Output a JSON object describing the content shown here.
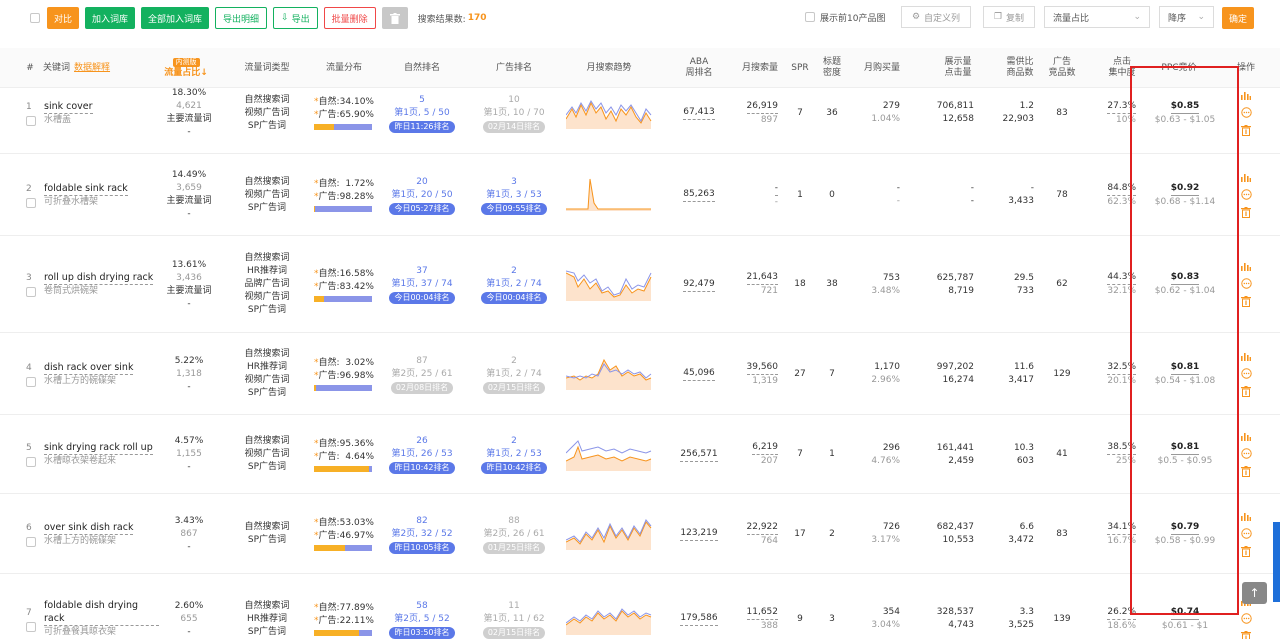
{
  "toolbar": {
    "compare": "对比",
    "add_to_library": "加入词库",
    "add_all_to_library": "全部加入词库",
    "export_details": "导出明细",
    "export": "导出",
    "batch_delete": "批量删除",
    "result_label": "搜索结果数:",
    "result_count": "170",
    "show_top10": "展示前10产品图",
    "custom": "自定义列",
    "copy": "复制",
    "sort_field": "流量占比",
    "sort_order": "降序",
    "confirm": "确定"
  },
  "header": {
    "hash": "#",
    "keyword": "关键词",
    "data_explain": "数据解释",
    "beta": "内测版",
    "flow_share": "流量占比↓",
    "flow_type": "流量词类型",
    "flow_dist": "流量分布",
    "organic_rank": "自然排名",
    "ad_rank": "广告排名",
    "monthly_trend": "月搜索趋势",
    "aba_1": "ABA",
    "aba_2": "周排名",
    "monthly_search": "月搜索量",
    "spr": "SPR",
    "title_1": "标题",
    "title_2": "密度",
    "monthly_buy": "月购买量",
    "impr_1": "展示量",
    "impr_2": "点击量",
    "supply_1": "需供比",
    "supply_2": "商品数",
    "ads_1": "广告",
    "ads_2": "竞品数",
    "click_1": "点击",
    "click_2": "集中度",
    "ppc": "PPC竞价",
    "ops": "操作"
  },
  "rows": [
    {
      "idx": "1",
      "kw": "sink cover",
      "kw_zh": "水槽盖",
      "share": "18.30%",
      "share_n": "4,621",
      "main": "主要流量词",
      "dash": "-",
      "types": [
        "自然搜索词",
        "视频广告词",
        "SP广告词"
      ],
      "org_label": "自然:",
      "org_pct": "34.10%",
      "ad_label": "广告:",
      "ad_pct": "65.90%",
      "org_frac": 0.341,
      "org_rank": "5",
      "org_page": "第1页, 5 / 50",
      "org_badge": "昨日11:26排名",
      "org_rank_c": "b",
      "ad_rank": "10",
      "ad_page": "第1页, 10 / 70",
      "ad_badge": "02月14日排名",
      "ad_rank_c": "g",
      "trend": "t1",
      "aba": "67,413",
      "ms": "26,919",
      "ms2": "897",
      "spr": "7",
      "td": "36",
      "mb": "279",
      "mb2": "1.04%",
      "imp": "706,811",
      "clk": "12,658",
      "sup": "1.2",
      "prod": "22,903",
      "ads": "83",
      "cc": "27.3%",
      "cc2": "10%",
      "ppc": "$0.85",
      "ppc_range": "$0.63 - $1.05"
    },
    {
      "idx": "2",
      "kw": "foldable sink rack",
      "kw_zh": "可折叠水槽架",
      "share": "14.49%",
      "share_n": "3,659",
      "main": "主要流量词",
      "dash": "-",
      "types": [
        "自然搜索词",
        "视频广告词",
        "SP广告词"
      ],
      "org_label": "自然:",
      "org_pct": "1.72%",
      "ad_label": "广告:",
      "ad_pct": "98.28%",
      "org_frac": 0.0172,
      "org_rank": "20",
      "org_page": "第1页, 20 / 50",
      "org_badge": "今日05:27排名",
      "org_rank_c": "b",
      "ad_rank": "3",
      "ad_page": "第1页, 3 / 53",
      "ad_badge": "今日09:55排名",
      "ad_rank_c": "b",
      "trend": "t2",
      "aba": "85,263",
      "ms": "-",
      "ms2": "-",
      "spr": "1",
      "td": "0",
      "mb": "-",
      "mb2": "-",
      "imp": "-",
      "clk": "-",
      "sup": "-",
      "prod": "3,433",
      "ads": "78",
      "cc": "84.8%",
      "cc2": "62.3%",
      "ppc": "$0.92",
      "ppc_range": "$0.68 - $1.14"
    },
    {
      "idx": "3",
      "kw": "roll up dish drying rack",
      "kw_zh": "卷筒式烘碗架",
      "share": "13.61%",
      "share_n": "3,436",
      "main": "主要流量词",
      "dash": "-",
      "types": [
        "自然搜索词",
        "HR推荐词",
        "品牌广告词",
        "视频广告词",
        "SP广告词"
      ],
      "org_label": "自然:",
      "org_pct": "16.58%",
      "ad_label": "广告:",
      "ad_pct": "83.42%",
      "org_frac": 0.1658,
      "org_rank": "37",
      "org_page": "第1页, 37 / 74",
      "org_badge": "今日00:04排名",
      "org_rank_c": "b",
      "ad_rank": "2",
      "ad_page": "第1页, 2 / 74",
      "ad_badge": "今日00:04排名",
      "ad_rank_c": "b",
      "trend": "t3",
      "aba": "92,479",
      "ms": "21,643",
      "ms2": "721",
      "spr": "18",
      "td": "38",
      "mb": "753",
      "mb2": "3.48%",
      "imp": "625,787",
      "clk": "8,719",
      "sup": "29.5",
      "prod": "733",
      "ads": "62",
      "cc": "44.3%",
      "cc2": "32.1%",
      "ppc": "$0.83",
      "ppc_range": "$0.62 - $1.04"
    },
    {
      "idx": "4",
      "kw": "dish rack over sink",
      "kw_zh": "水槽上方的碗碟架",
      "share": "5.22%",
      "share_n": "1,318",
      "main": "",
      "dash": "-",
      "types": [
        "自然搜索词",
        "HR推荐词",
        "视频广告词",
        "SP广告词"
      ],
      "org_label": "自然:",
      "org_pct": "3.02%",
      "ad_label": "广告:",
      "ad_pct": "96.98%",
      "org_frac": 0.0302,
      "org_rank": "87",
      "org_page": "第2页, 25 / 61",
      "org_badge": "02月08日排名",
      "org_rank_c": "g",
      "ad_rank": "2",
      "ad_page": "第1页, 2 / 74",
      "ad_badge": "02月15日排名",
      "ad_rank_c": "g",
      "trend": "t4",
      "aba": "45,096",
      "ms": "39,560",
      "ms2": "1,319",
      "spr": "27",
      "td": "7",
      "mb": "1,170",
      "mb2": "2.96%",
      "imp": "997,202",
      "clk": "16,274",
      "sup": "11.6",
      "prod": "3,417",
      "ads": "129",
      "cc": "32.5%",
      "cc2": "20.1%",
      "ppc": "$0.81",
      "ppc_range": "$0.54 - $1.08"
    },
    {
      "idx": "5",
      "kw": "sink drying rack roll up",
      "kw_zh": "水槽晾衣架卷起来",
      "share": "4.57%",
      "share_n": "1,155",
      "main": "",
      "dash": "-",
      "types": [
        "自然搜索词",
        "视频广告词",
        "SP广告词"
      ],
      "org_label": "自然:",
      "org_pct": "95.36%",
      "ad_label": "广告:",
      "ad_pct": "4.64%",
      "org_frac": 0.9536,
      "org_rank": "26",
      "org_page": "第1页, 26 / 53",
      "org_badge": "昨日10:42排名",
      "org_rank_c": "b",
      "ad_rank": "2",
      "ad_page": "第1页, 2 / 53",
      "ad_badge": "昨日10:42排名",
      "ad_rank_c": "b",
      "trend": "t5",
      "aba": "256,571",
      "ms": "6,219",
      "ms2": "207",
      "spr": "7",
      "td": "1",
      "mb": "296",
      "mb2": "4.76%",
      "imp": "161,441",
      "clk": "2,459",
      "sup": "10.3",
      "prod": "603",
      "ads": "41",
      "cc": "38.5%",
      "cc2": "25%",
      "ppc": "$0.81",
      "ppc_range": "$0.5 - $0.95"
    },
    {
      "idx": "6",
      "kw": "over sink dish rack",
      "kw_zh": "水槽上方的碗碟架",
      "share": "3.43%",
      "share_n": "867",
      "main": "",
      "dash": "-",
      "types": [
        "自然搜索词",
        "SP广告词"
      ],
      "org_label": "自然:",
      "org_pct": "53.03%",
      "ad_label": "广告:",
      "ad_pct": "46.97%",
      "org_frac": 0.5303,
      "org_rank": "82",
      "org_page": "第2页, 32 / 52",
      "org_badge": "昨日10:05排名",
      "org_rank_c": "b",
      "ad_rank": "88",
      "ad_page": "第2页, 26 / 61",
      "ad_badge": "01月25日排名",
      "ad_rank_c": "g",
      "trend": "t6",
      "aba": "123,219",
      "ms": "22,922",
      "ms2": "764",
      "spr": "17",
      "td": "2",
      "mb": "726",
      "mb2": "3.17%",
      "imp": "682,437",
      "clk": "10,553",
      "sup": "6.6",
      "prod": "3,472",
      "ads": "83",
      "cc": "34.1%",
      "cc2": "16.7%",
      "ppc": "$0.79",
      "ppc_range": "$0.58 - $0.99"
    },
    {
      "idx": "7",
      "kw": "foldable dish drying rack",
      "kw_zh": "可折叠餐具晾衣架",
      "share": "2.60%",
      "share_n": "655",
      "main": "",
      "dash": "-",
      "types": [
        "自然搜索词",
        "HR推荐词",
        "SP广告词"
      ],
      "org_label": "自然:",
      "org_pct": "77.89%",
      "ad_label": "广告:",
      "ad_pct": "22.11%",
      "org_frac": 0.7789,
      "org_rank": "58",
      "org_page": "第2页, 5 / 52",
      "org_badge": "昨日03:50排名",
      "org_rank_c": "b",
      "ad_rank": "11",
      "ad_page": "第1页, 11 / 62",
      "ad_badge": "02月15日排名",
      "ad_rank_c": "g",
      "trend": "t7",
      "aba": "179,586",
      "ms": "11,652",
      "ms2": "388",
      "spr": "9",
      "td": "3",
      "mb": "354",
      "mb2": "3.04%",
      "imp": "328,537",
      "clk": "4,743",
      "sup": "3.3",
      "prod": "3,525",
      "ads": "139",
      "cc": "26.2%",
      "cc2": "18.6%",
      "ppc": "$0.74",
      "ppc_range": "$0.61 - $1"
    }
  ]
}
